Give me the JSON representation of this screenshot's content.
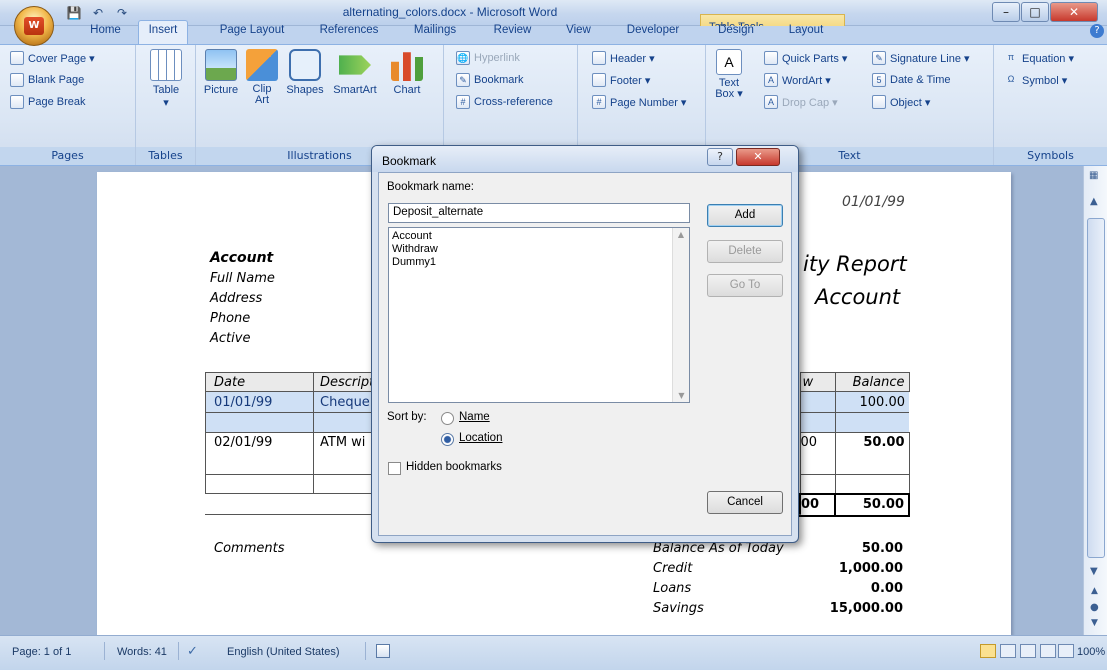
{
  "window": {
    "title": "alternating_colors.docx - Microsoft Word",
    "context_tab_group": "Table Tools"
  },
  "quick_access": {
    "save": "💾",
    "undo": "↶",
    "redo": "↷"
  },
  "tabs": [
    "Home",
    "Insert",
    "Page Layout",
    "References",
    "Mailings",
    "Review",
    "View",
    "Developer",
    "Design",
    "Layout"
  ],
  "ribbon": {
    "pages": {
      "label": "Pages",
      "items": [
        "Cover Page ▾",
        "Blank Page",
        "Page Break"
      ]
    },
    "tables": {
      "label": "Tables",
      "table": "Table"
    },
    "illustrations": {
      "label": "Illustrations",
      "picture": "Picture",
      "clip_art": "Clip Art",
      "shapes": "Shapes",
      "smartart": "SmartArt",
      "chart": "Chart"
    },
    "links": {
      "hyperlink": "Hyperlink",
      "bookmark": "Bookmark",
      "cross_reference": "Cross-reference"
    },
    "header_footer": {
      "header": "Header ▾",
      "footer": "Footer ▾",
      "page_number": "Page Number ▾"
    },
    "text": {
      "label": "Text",
      "text_box": "Text Box ▾",
      "quick_parts": "Quick Parts ▾",
      "wordart": "WordArt ▾",
      "drop_cap": "Drop Cap ▾",
      "signature_line": "Signature Line ▾",
      "date_time": "Date & Time",
      "object": "Object ▾"
    },
    "symbols": {
      "label": "Symbols",
      "equation": "Equation ▾",
      "symbol": "Symbol ▾"
    }
  },
  "document": {
    "date": "01/01/99",
    "account_heading": "Account",
    "fields": [
      "Full Name",
      "Address",
      "Phone",
      "Active"
    ],
    "report_title": "ity Report",
    "report_subtitle": "Account",
    "table": {
      "headers": [
        "Date",
        "Descripti",
        "w",
        "Balance"
      ],
      "rows": [
        [
          "01/01/99",
          "Cheque",
          "",
          "100.00"
        ],
        [
          "",
          "",
          "",
          ""
        ],
        [
          "02/01/99",
          "ATM wi",
          "00",
          "50.00"
        ],
        [
          "",
          "",
          "",
          ""
        ]
      ],
      "total": [
        "00",
        "50.00"
      ]
    },
    "comments_label": "Comments",
    "summary": [
      {
        "label": "Balance As of Today",
        "value": "50.00"
      },
      {
        "label": "Credit",
        "value": "1,000.00"
      },
      {
        "label": "Loans",
        "value": "0.00"
      },
      {
        "label": "Savings",
        "value": "15,000.00"
      }
    ]
  },
  "dialog": {
    "title": "Bookmark",
    "name_label": "Bookmark name:",
    "name_value": "Deposit_alternate",
    "bookmarks": [
      "Account",
      "Withdraw",
      "Dummy1"
    ],
    "sort_by_label": "Sort by:",
    "sort_options": [
      "Name",
      "Location"
    ],
    "sort_selected": "Location",
    "hidden_label": "Hidden bookmarks",
    "buttons": {
      "add": "Add",
      "delete": "Delete",
      "go_to": "Go To",
      "cancel": "Cancel"
    }
  },
  "statusbar": {
    "page": "Page: 1 of 1",
    "words": "Words: 41",
    "language": "English (United States)",
    "zoom": "100%"
  }
}
